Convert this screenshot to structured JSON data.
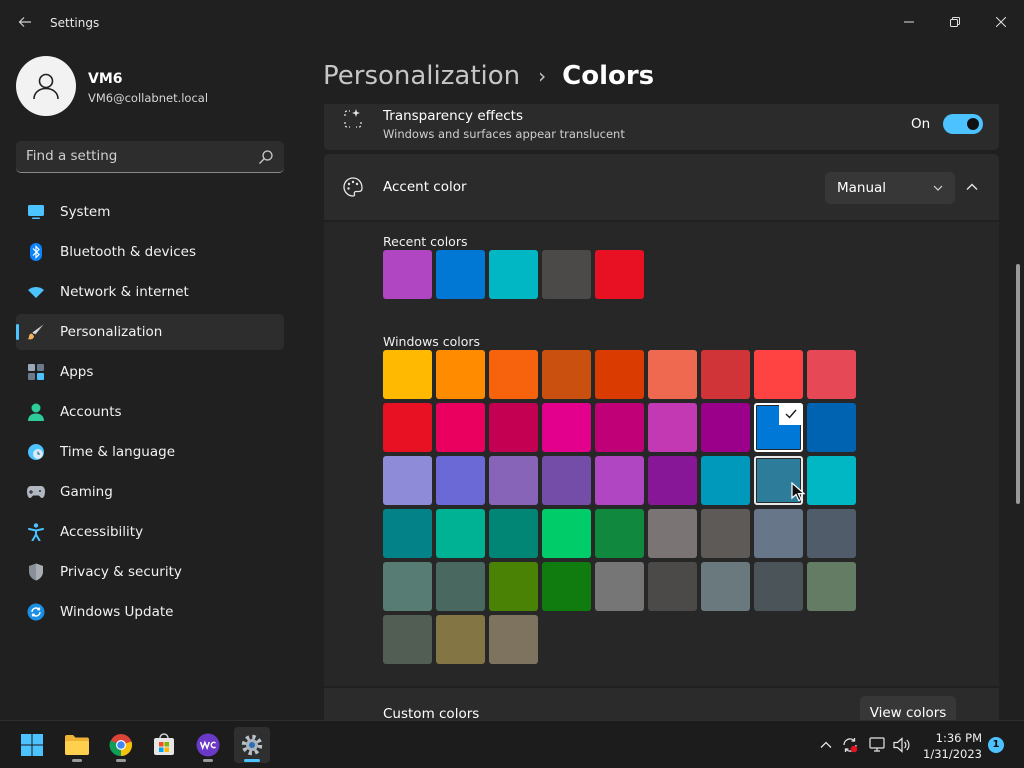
{
  "window": {
    "title": "Settings"
  },
  "profile": {
    "name": "VM6",
    "email": "VM6@collabnet.local"
  },
  "search": {
    "placeholder": "Find a setting"
  },
  "sidebar": {
    "items": [
      {
        "label": "System",
        "icon": "monitor-icon"
      },
      {
        "label": "Bluetooth & devices",
        "icon": "bluetooth-icon"
      },
      {
        "label": "Network & internet",
        "icon": "wifi-icon"
      },
      {
        "label": "Personalization",
        "icon": "paintbrush-icon",
        "active": true
      },
      {
        "label": "Apps",
        "icon": "apps-icon"
      },
      {
        "label": "Accounts",
        "icon": "person-icon"
      },
      {
        "label": "Time & language",
        "icon": "clock-globe-icon"
      },
      {
        "label": "Gaming",
        "icon": "gamepad-icon"
      },
      {
        "label": "Accessibility",
        "icon": "accessibility-icon"
      },
      {
        "label": "Privacy & security",
        "icon": "shield-icon"
      },
      {
        "label": "Windows Update",
        "icon": "update-icon"
      }
    ]
  },
  "breadcrumb": {
    "parent": "Personalization",
    "separator": "›",
    "current": "Colors"
  },
  "transparency": {
    "title": "Transparency effects",
    "description": "Windows and surfaces appear translucent",
    "state": "On",
    "enabled": true
  },
  "accent": {
    "title": "Accent color",
    "mode": "Manual",
    "recent_label": "Recent colors",
    "recent_colors": [
      "#b146c2",
      "#0078d4",
      "#00b7c3",
      "#4c4a48",
      "#e81123"
    ],
    "windows_label": "Windows colors",
    "windows_colors": [
      [
        "#ffb900",
        "#ff8c00",
        "#f7630c",
        "#ca5010",
        "#da3b01",
        "#ef6950",
        "#d13438",
        "#ff4343",
        "#e74856"
      ],
      [
        "#e81123",
        "#ea005e",
        "#c30052",
        "#e3008c",
        "#bf0077",
        "#c239b3",
        "#9a0089",
        "#0078d7",
        "#0063b1"
      ],
      [
        "#8e8cd8",
        "#6b69d6",
        "#8764b8",
        "#744da9",
        "#b146c2",
        "#881798",
        "#0099bc",
        "#2d7d9a",
        "#00b7c3"
      ],
      [
        "#038387",
        "#00b294",
        "#018574",
        "#00cc6a",
        "#10893e",
        "#7a7574",
        "#5d5a58",
        "#68768a",
        "#515c6b"
      ],
      [
        "#567c73",
        "#486860",
        "#498205",
        "#107c10",
        "#767676",
        "#4c4a48",
        "#69797e",
        "#4a5459",
        "#647c64"
      ],
      [
        "#525e54",
        "#847545",
        "#7e735f"
      ]
    ],
    "selected_color": "#0078d7",
    "hovered_color": "#2d7d9a"
  },
  "custom_colors": {
    "title": "Custom colors",
    "button_label": "View colors"
  },
  "taskbar": {
    "apps": [
      {
        "name": "start-button",
        "icon": "windows-logo-icon"
      },
      {
        "name": "file-explorer",
        "icon": "folder-icon"
      },
      {
        "name": "chrome",
        "icon": "chrome-icon"
      },
      {
        "name": "microsoft-store",
        "icon": "store-icon"
      },
      {
        "name": "webex",
        "icon": "webex-icon"
      },
      {
        "name": "settings",
        "icon": "gear-icon",
        "active": true
      }
    ],
    "time": "1:36 PM",
    "date": "1/31/2023",
    "notification_count": "1"
  }
}
